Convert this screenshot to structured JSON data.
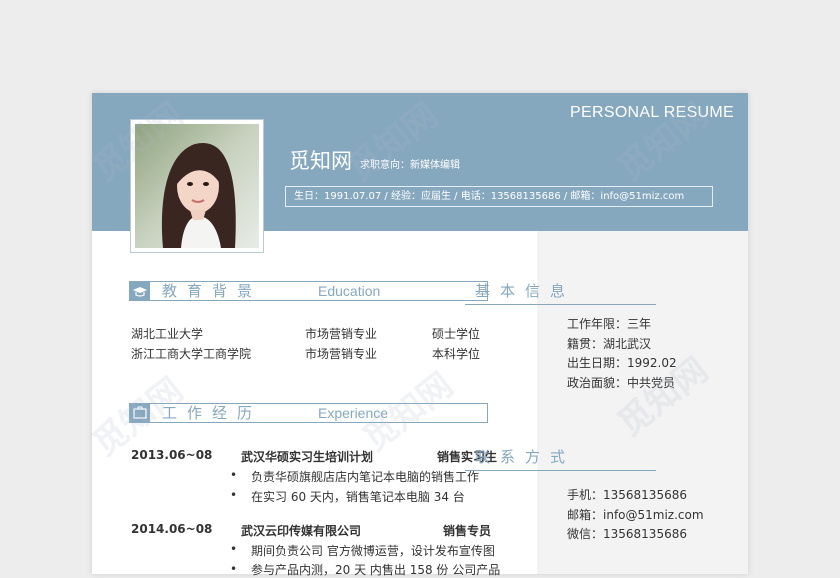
{
  "header": {
    "title": "PERSONAL RESUME",
    "name": "觅知网",
    "intent": "求职意向：新媒体编辑",
    "info": "生日：1991.07.07   /   经验：应届生   /   电话：13568135686   /   邮箱：info@51miz.com"
  },
  "education": {
    "title_cn": "教育背景",
    "title_en": "Education",
    "rows": [
      {
        "school": "湖北工业大学",
        "major": "市场营销专业",
        "degree": "硕士学位"
      },
      {
        "school": "浙江工商大学工商学院",
        "major": "市场营销专业",
        "degree": "本科学位"
      }
    ]
  },
  "experience": {
    "title_cn": "工作经历",
    "title_en": "Experience",
    "jobs": [
      {
        "date": "2013.06~08",
        "company": "武汉华硕实习生培训计划",
        "role": "销售实习生",
        "bullets": [
          "负责华硕旗舰店店内笔记本电脑的销售工作",
          "在实习 60 天内，销售笔记本电脑 34 台"
        ]
      },
      {
        "date": "2014.06~08",
        "company": "武汉云印传媒有限公司",
        "role": "销售专员",
        "bullets": [
          "期间负责公司 官方微博运营，设计发布宣传图",
          "参与产品内测，20 天 内售出 158 份 公司产品"
        ]
      }
    ]
  },
  "basic_info": {
    "title": "基本信息",
    "items": [
      "工作年限：三年",
      "籍贯：湖北武汉",
      "出生日期：1992.02",
      "政治面貌：中共党员"
    ]
  },
  "contact": {
    "title": "联系方式",
    "items": [
      "手机：13568135686",
      "邮箱：info@51miz.com",
      "微信：13568135686"
    ]
  },
  "watermark": "觅知网",
  "colors": {
    "accent": "#86a8bf",
    "sidebar": "#f3f3f3"
  }
}
